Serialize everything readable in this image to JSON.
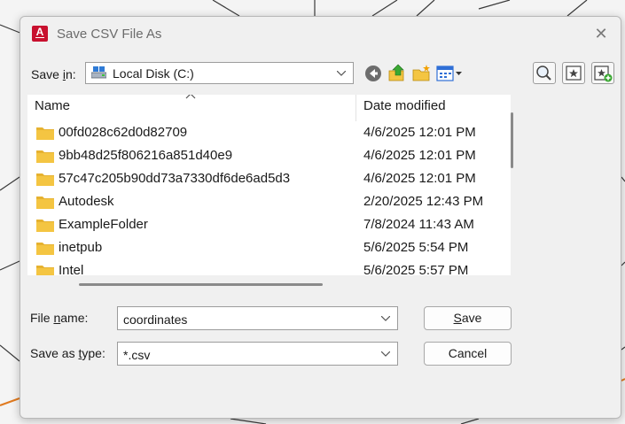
{
  "window": {
    "title": "Save CSV File As",
    "app_icon_letter": "A",
    "close_glyph": "✕"
  },
  "save_in": {
    "label_prefix": "Save ",
    "label_accel": "i",
    "label_suffix": "n:",
    "location": "Local Disk (C:)",
    "location_icon": "drive-icon"
  },
  "toolbar": {
    "icons": [
      "back-icon",
      "up-folder-icon",
      "new-folder-icon",
      "view-menu-icon"
    ],
    "right_icons": [
      "search-web-icon",
      "favorites-icon",
      "add-favorite-icon"
    ]
  },
  "file_list": {
    "columns": {
      "name": "Name",
      "date": "Date modified"
    },
    "rows": [
      {
        "name": "00fd028c62d0d82709",
        "date": "4/6/2025 12:01 PM"
      },
      {
        "name": "9bb48d25f806216a851d40e9",
        "date": "4/6/2025 12:01 PM"
      },
      {
        "name": "57c47c205b90dd73a7330df6de6ad5d3",
        "date": "4/6/2025 12:01 PM"
      },
      {
        "name": "Autodesk",
        "date": "2/20/2025 12:43 PM"
      },
      {
        "name": "ExampleFolder",
        "date": "7/8/2024 11:43 AM"
      },
      {
        "name": "inetpub",
        "date": "5/6/2025 5:54 PM"
      },
      {
        "name": "Intel",
        "date": "5/6/2025 5:57 PM"
      }
    ]
  },
  "file_name": {
    "label_prefix": "File ",
    "label_accel": "n",
    "label_suffix": "ame:",
    "value": "coordinates"
  },
  "save_as_type": {
    "label_prefix": "Save as ",
    "label_accel": "t",
    "label_suffix": "ype:",
    "value": "*.csv"
  },
  "buttons": {
    "save_accel": "S",
    "save_rest": "ave",
    "cancel": "Cancel"
  },
  "colors": {
    "folder": "#f4c542",
    "app_icon": "#c8102e"
  }
}
